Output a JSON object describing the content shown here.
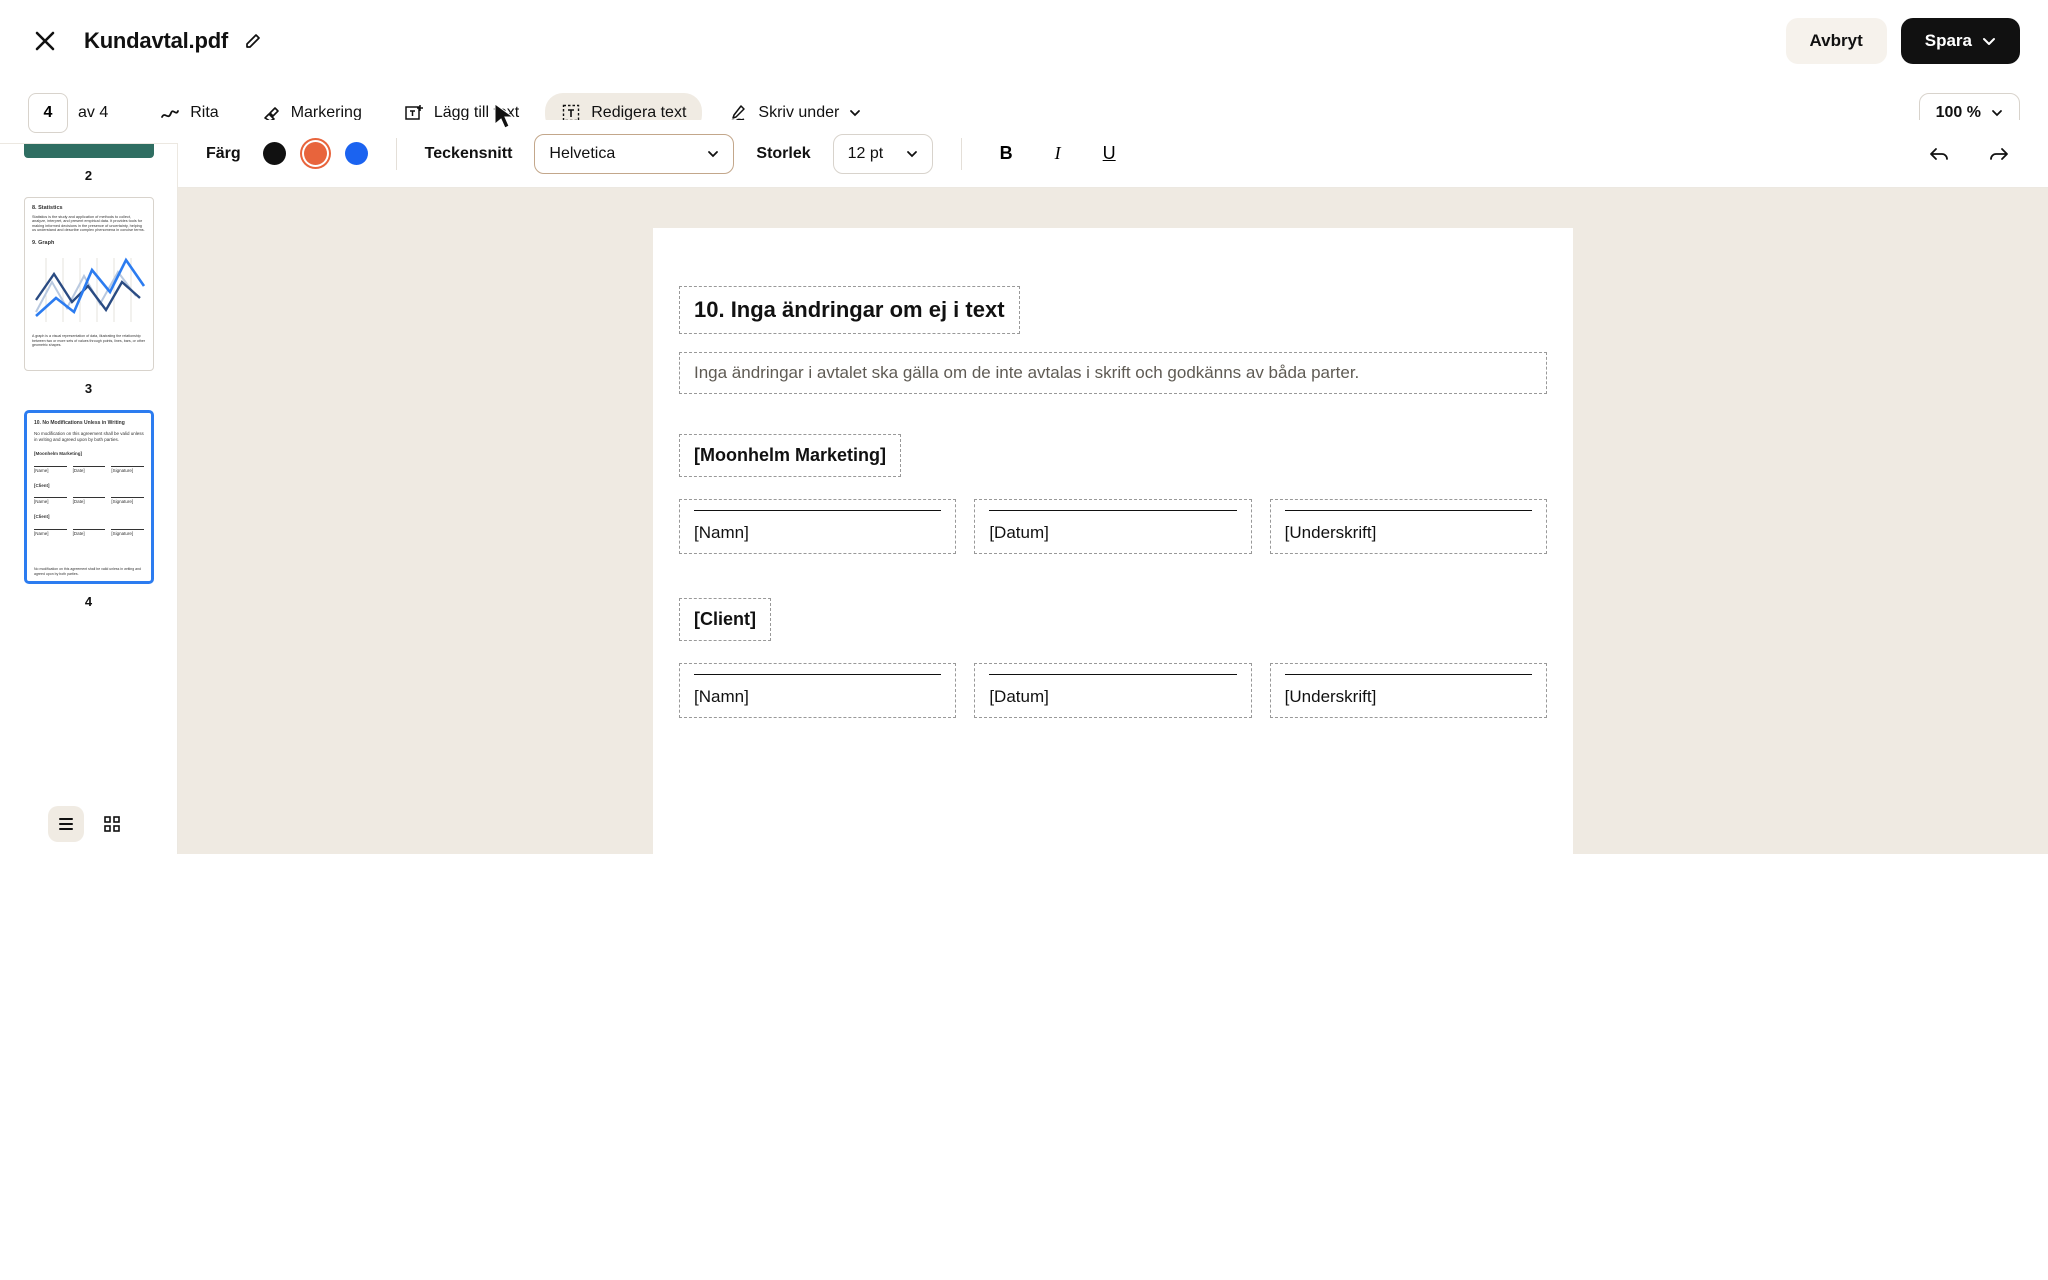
{
  "header": {
    "document_title": "Kundavtal.pdf",
    "cancel": "Avbryt",
    "save": "Spara"
  },
  "toolbar": {
    "page_current": "4",
    "page_total": "av 4",
    "tools": {
      "draw": "Rita",
      "highlight": "Markering",
      "add_text": "Lägg till text",
      "edit_text": "Redigera text",
      "sign": "Skriv under"
    },
    "zoom": "100 %"
  },
  "formatbar": {
    "color_label": "Färg",
    "colors": {
      "black": "#111111",
      "orange": "#E8643C",
      "blue": "#1B63F0"
    },
    "font_label": "Teckensnitt",
    "font_value": "Helvetica",
    "size_label": "Storlek",
    "size_value": "12 pt"
  },
  "thumbs": {
    "p2": {
      "num": "2"
    },
    "p3": {
      "num": "3",
      "h1": "8. Statistics",
      "body1": "Statistics is the study and application of methods to collect, analyze, interpret, and present empirical data. It provides tools for making informed decisions in the presence of uncertainty, helping us understand and describe complex phenomena in concise terms.",
      "h2": "9. Graph",
      "caption": "A graph is a visual representation of data, illustrating the relationship between two or more sets of values through points, lines, bars, or other geometric shapes."
    },
    "p4": {
      "num": "4",
      "title": "10. No Modifications Unless in Writing",
      "body": "No modification on this agreement shall be valid unless in writing and agreed upon by both parties.",
      "party1": "[Moonhelm Marketing]",
      "party2": "[Client]",
      "c1": "[Name]",
      "c2": "[Date]",
      "c3": "[Signature]",
      "footer": "No modification on this agreement shall be valid unless in writing and agreed upon by both parties."
    }
  },
  "page": {
    "section_title": "10. Inga ändringar om ej i text",
    "section_body": "Inga ändringar i avtalet ska gälla om de inte avtalas i skrift och godkänns av båda parter.",
    "party1": "[Moonhelm Marketing]",
    "party2": "[Client]",
    "name": "[Namn]",
    "date": "[Datum]",
    "signature": "[Underskrift]"
  }
}
